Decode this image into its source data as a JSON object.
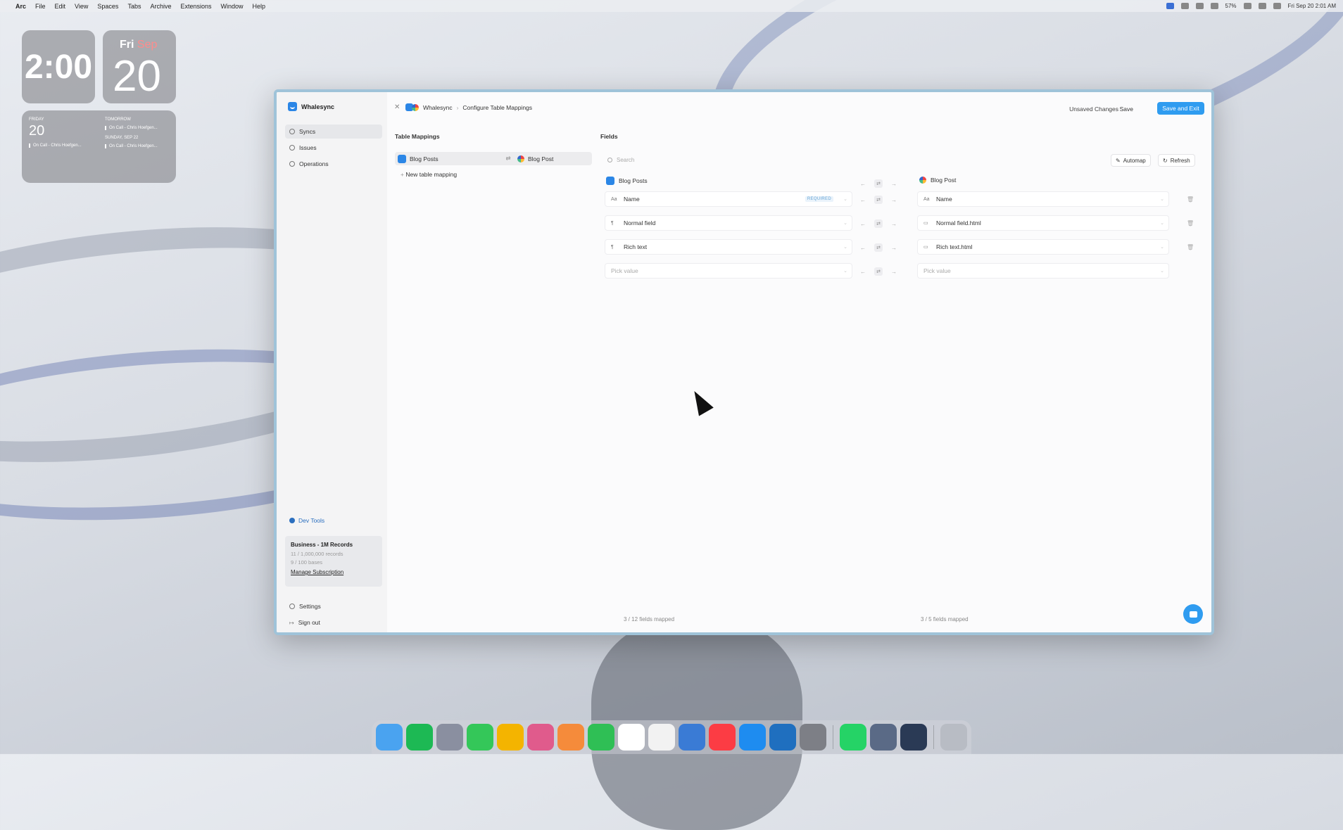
{
  "menubar": {
    "items": [
      "Arc",
      "File",
      "Edit",
      "View",
      "Spaces",
      "Tabs",
      "Archive",
      "Extensions",
      "Window",
      "Help"
    ],
    "battery": "57%",
    "datetime": "Fri Sep 20  2:01 AM"
  },
  "widgets": {
    "clock": "2:00",
    "date_day": "Fri",
    "date_month": "Sep",
    "date_num": "20",
    "cal_left_label": "FRIDAY",
    "cal_left_num": "20",
    "cal_left_event": "On Call - Chris Hoefgen...",
    "cal_right_label": "TOMORROW",
    "cal_right_event1": "On Call - Chris Hoefgen...",
    "cal_right_label2": "SUNDAY, SEP 22",
    "cal_right_event2": "On Call - Chris Hoefgen..."
  },
  "sidebar": {
    "brand": "Whalesync",
    "items": [
      {
        "label": "Syncs",
        "icon": "sync-icon",
        "active": true
      },
      {
        "label": "Issues",
        "icon": "issues-icon",
        "active": false
      },
      {
        "label": "Operations",
        "icon": "operations-icon",
        "active": false
      }
    ],
    "devtools": "Dev Tools",
    "plan": {
      "title": "Business - 1M Records",
      "records": "11 / 1,000,000 records",
      "bases": "9 / 100 bases",
      "manage": "Manage Subscription"
    },
    "settings": "Settings",
    "signout": "Sign out"
  },
  "header": {
    "crumb_app": "Whalesync",
    "crumb_page": "Configure Table Mappings",
    "unsaved": "Unsaved Changes",
    "save": "Save",
    "save_exit": "Save and Exit"
  },
  "table_mappings": {
    "title": "Table Mappings",
    "left": "Blog Posts",
    "right": "Blog Post",
    "new": "New table mapping"
  },
  "fields": {
    "title": "Fields",
    "search_placeholder": "Search",
    "automap": "Automap",
    "refresh": "Refresh",
    "left_table": "Blog Posts",
    "right_table": "Blog Post",
    "rows": [
      {
        "left": "Name",
        "left_type": "Aa",
        "required": "REQUIRED",
        "right": "Name",
        "right_type": "Aa"
      },
      {
        "left": "Normal field",
        "left_type": "¶",
        "right": "Normal field.html",
        "right_type": "▭"
      },
      {
        "left": "Rich text",
        "left_type": "¶",
        "right": "Rich text.html",
        "right_type": "▭"
      }
    ],
    "pick_left": "Pick value",
    "pick_right": "Pick value",
    "left_count": "3 / 12 fields mapped",
    "right_count": "3 / 5 fields mapped"
  },
  "colors": {
    "accent": "#2f9cf0",
    "window_border": "#9fc3d9"
  }
}
